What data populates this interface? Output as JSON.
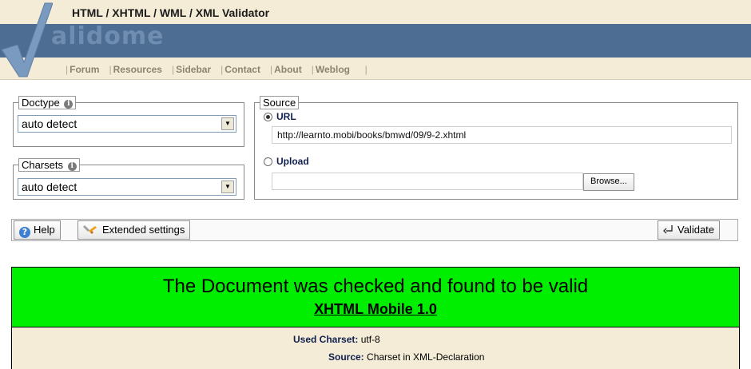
{
  "header": {
    "title": "HTML / XHTML / WML / XML Validator",
    "logo_text": "alidome",
    "nav": [
      {
        "label": "Forum"
      },
      {
        "label": "Resources"
      },
      {
        "label": "Sidebar"
      },
      {
        "label": "Contact"
      },
      {
        "label": "About"
      },
      {
        "label": "Weblog"
      }
    ]
  },
  "doctype": {
    "legend": "Doctype",
    "value": "auto detect"
  },
  "charsets": {
    "legend": "Charsets",
    "value": "auto detect"
  },
  "source": {
    "legend": "Source",
    "url_label": "URL",
    "url_value": "http://learnto.mobi/books/bmwd/09/9-2.xhtml",
    "upload_label": "Upload",
    "upload_value": "",
    "browse_label": "Browse..."
  },
  "toolbar": {
    "help_label": "Help",
    "extended_label": "Extended settings",
    "validate_label": "Validate"
  },
  "result": {
    "message": "The Document was checked and found to be valid",
    "doctype": "XHTML Mobile 1.0",
    "charset_label": "Used Charset:",
    "charset_value": "utf-8",
    "source_label": "Source:",
    "source_value": "Charset in XML-Declaration",
    "status_color": "#00ee00"
  }
}
